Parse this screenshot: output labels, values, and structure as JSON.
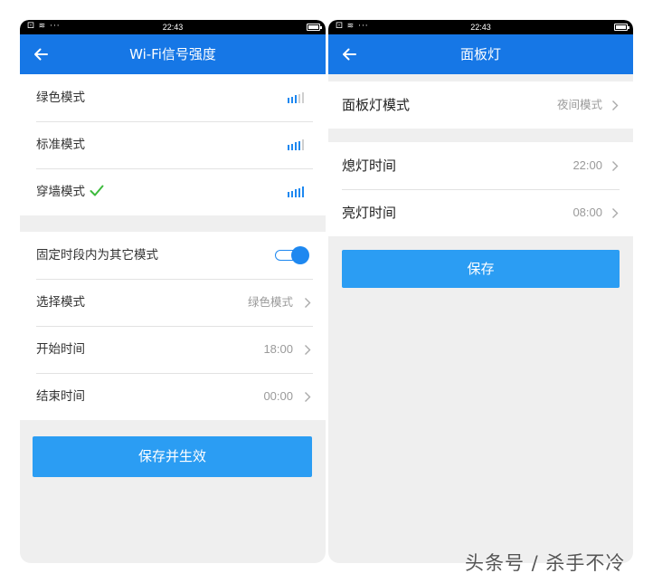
{
  "status_bar": {
    "left_icons": "⚀ ≋ ···",
    "time": "22:43"
  },
  "wifi_screen": {
    "title": "Wi-Fi信号强度",
    "modes": [
      {
        "label": "绿色模式",
        "signal_bars": 3,
        "selected": false
      },
      {
        "label": "标准模式",
        "signal_bars": 4,
        "selected": false
      },
      {
        "label": "穿墙模式",
        "signal_bars": 5,
        "selected": true
      }
    ],
    "schedule": {
      "toggle_label": "固定时段内为其它模式",
      "toggle_on": true,
      "select_mode_label": "选择模式",
      "select_mode_value": "绿色模式",
      "start_label": "开始时间",
      "start_value": "18:00",
      "end_label": "结束时间",
      "end_value": "00:00"
    },
    "save_label": "保存并生效"
  },
  "panel_screen": {
    "title": "面板灯",
    "mode_label": "面板灯模式",
    "mode_value": "夜间模式",
    "off_label": "熄灯时间",
    "off_value": "22:00",
    "on_label": "亮灯时间",
    "on_value": "08:00",
    "save_label": "保存"
  },
  "watermark": "头条号 / 杀手不冷",
  "colors": {
    "primary": "#1677e6",
    "button": "#2b9df3",
    "signal_active": "#1e88f0",
    "signal_inactive": "#cfcfcf",
    "check": "#3cba3c"
  }
}
